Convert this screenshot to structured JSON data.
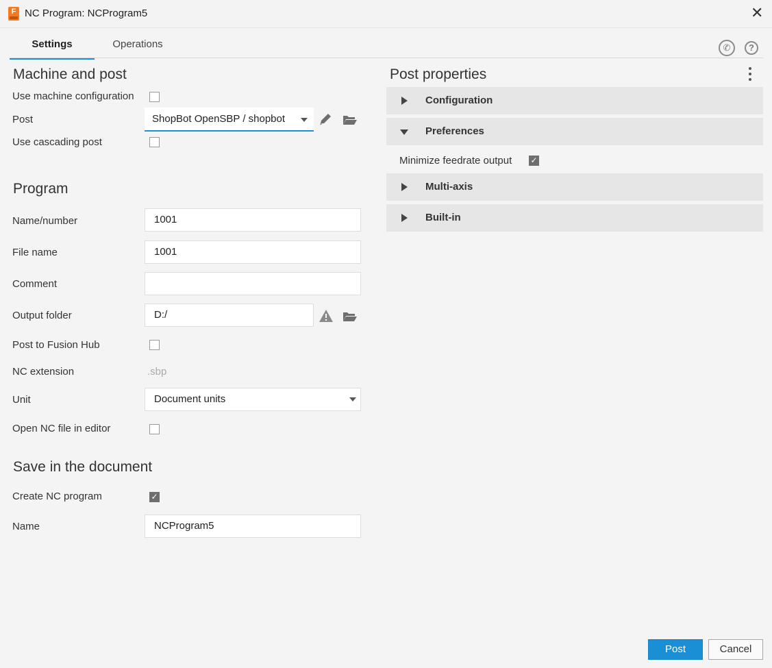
{
  "window": {
    "title": "NC Program: NCProgram5",
    "app_icon_letter": "F"
  },
  "tabs": [
    {
      "label": "Settings",
      "active": true
    },
    {
      "label": "Operations",
      "active": false
    }
  ],
  "header_icons": [
    "phone-icon",
    "help-icon"
  ],
  "machine_and_post": {
    "heading": "Machine and post",
    "use_machine_config_label": "Use machine configuration",
    "use_machine_config_checked": false,
    "post_label": "Post",
    "post_value": "ShopBot OpenSBP / shopbot",
    "use_cascading_post_label": "Use cascading post",
    "use_cascading_post_checked": false
  },
  "program": {
    "heading": "Program",
    "name_number_label": "Name/number",
    "name_number_value": "1001",
    "file_name_label": "File name",
    "file_name_value": "1001",
    "comment_label": "Comment",
    "comment_value": "",
    "output_folder_label": "Output folder",
    "output_folder_value": "D:/",
    "post_to_hub_label": "Post to Fusion Hub",
    "post_to_hub_checked": false,
    "nc_extension_label": "NC extension",
    "nc_extension_value": ".sbp",
    "unit_label": "Unit",
    "unit_value": "Document units",
    "open_nc_label": "Open NC file in editor",
    "open_nc_checked": false
  },
  "save": {
    "heading": "Save in the document",
    "create_nc_label": "Create NC program",
    "create_nc_checked": true,
    "name_label": "Name",
    "name_value": "NCProgram5"
  },
  "post_properties": {
    "heading": "Post properties",
    "groups": [
      {
        "label": "Configuration",
        "expanded": false
      },
      {
        "label": "Preferences",
        "expanded": true
      },
      {
        "label": "Multi-axis",
        "expanded": false
      },
      {
        "label": "Built-in",
        "expanded": false
      }
    ],
    "minimize_feedrate_label": "Minimize feedrate output",
    "minimize_feedrate_checked": true
  },
  "buttons": {
    "post": "Post",
    "cancel": "Cancel"
  },
  "colors": {
    "accent": "#1a8fd6",
    "app_icon": "#f47a20",
    "group_bg": "#e6e6e6"
  }
}
